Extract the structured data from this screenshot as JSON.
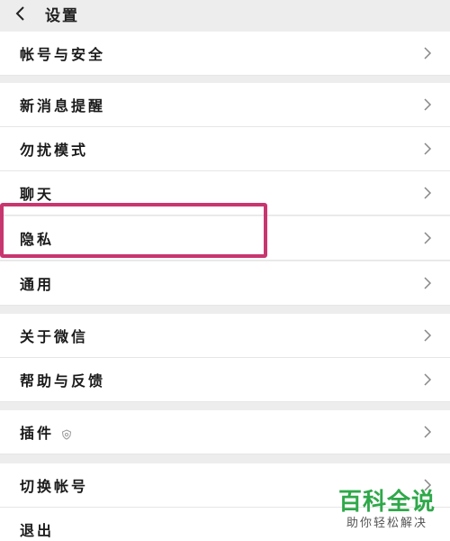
{
  "header": {
    "title": "设置",
    "back_icon": "chevron-left-icon"
  },
  "settings": {
    "account_security": "帐号与安全",
    "new_message_notify": "新消息提醒",
    "do_not_disturb": "勿扰模式",
    "chat": "聊天",
    "privacy": "隐私",
    "general": "通用",
    "about_wechat": "关于微信",
    "help_feedback": "帮助与反馈",
    "plugins": "插件",
    "switch_account": "切换帐号",
    "logout": "退出"
  },
  "watermark": {
    "title": "百科全说",
    "subtitle": "助你轻松解决"
  },
  "colors": {
    "highlight": "#c8366f",
    "watermark": "#2fa84a"
  }
}
